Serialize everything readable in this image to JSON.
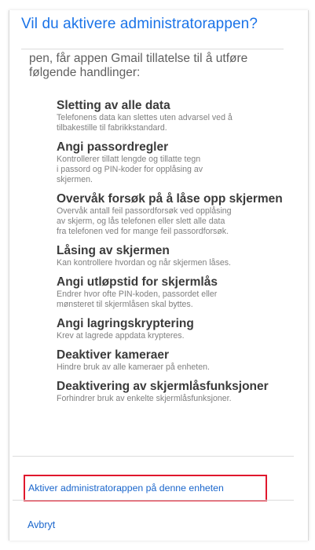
{
  "dialog": {
    "title": "Vil du aktivere administratorappen?",
    "intro": "pen, får appen Gmail tillatelse til å utføre følgende handlinger:",
    "permissions": [
      {
        "title": "Sletting av alle data",
        "description_lines": [
          "Telefonens data kan slettes uten advarsel ved å",
          "tilbakestille til fabrikkstandard."
        ]
      },
      {
        "title": "Angi passordregler",
        "description_lines": [
          "Kontrollerer tillatt lengde og tillatte tegn",
          "i passord og PIN-koder for opplåsing av",
          "skjermen."
        ]
      },
      {
        "title": "Overvåk forsøk på å låse opp skjermen",
        "description_lines": [
          "Overvåk antall feil passordforsøk ved opplåsing",
          "av skjerm, og lås telefonen eller slett alle data",
          "fra telefonen ved for mange feil passordforsøk."
        ]
      },
      {
        "title": "Låsing av skjermen",
        "description_lines": [
          "Kan kontrollere hvordan og når skjermen låses."
        ]
      },
      {
        "title": "Angi utløpstid for skjermlås",
        "description_lines": [
          "Endrer hvor ofte PIN-koden, passordet eller",
          "mønsteret til skjermlåsen skal byttes."
        ]
      },
      {
        "title": "Angi lagringskryptering",
        "description_lines": [
          "Krev at lagrede appdata krypteres."
        ]
      },
      {
        "title": "Deaktiver kameraer",
        "description_lines": [
          "Hindre bruk av alle kameraer på enheten."
        ]
      },
      {
        "title": "Deaktivering av skjermlåsfunksjoner",
        "description_lines": [
          "Forhindrer bruk av enkelte skjermlåsfunksjoner."
        ]
      }
    ],
    "activate_label": "Aktiver administratorappen på denne enheten",
    "cancel_label": "Avbryt"
  },
  "colors": {
    "title": "#1a73e8",
    "link": "#1a66cc",
    "highlight_border": "#e0182d"
  }
}
